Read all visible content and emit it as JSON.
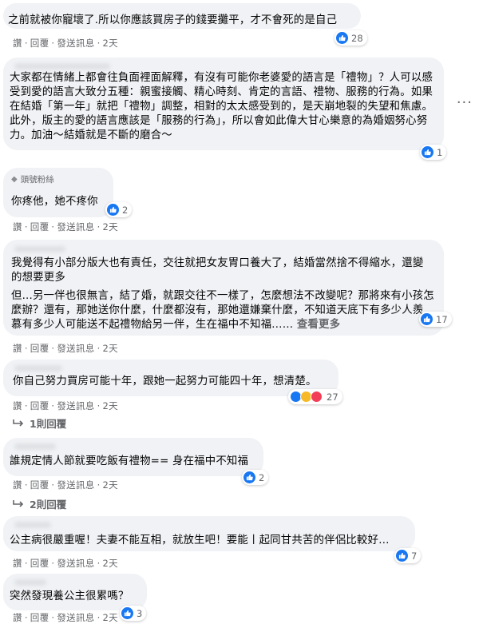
{
  "comments": [
    {
      "text": "之前就被你寵壞了.所以你應該買房子的錢要攤平，才不會死的是自己",
      "reactions": "28",
      "time": "2天"
    },
    {
      "text": "大家都在情緒上都會往負面裡面解釋，有沒有可能你老婆愛的語言是「禮物」？人可以感受到愛的語言大致分五種：親蜜接觸、精心時刻、肯定的言語、禮物、服務的行為。如果在結婚「第一年」就把「禮物」調整，相對的太太感受到的，是天崩地裂的失望和焦慮。此外，版主的愛的語言應該是「服務的行為」，所以會如此偉大甘心樂意的為婚姻努心努力。加油～結婚就是不斷的磨合～",
      "reactions": "1"
    },
    {
      "badge": "頭號粉絲",
      "text": "你疼他，她不疼你",
      "reactions": "2",
      "time": "2天"
    },
    {
      "text": "我覺得有小部分版大也有責任，交往就把女友胃口養大了，結婚當然捨不得縮水，還變的想要更多",
      "text2": "但...另一伴也很無言，結了婚，就跟交往不一樣了，怎麼想法不改變呢？那將來有小孩怎麼辦？還有，那她送你什麼，什麼都沒有，那她還嫌棄什麼，不知道天底下有多少人羨慕有多少人可能送不起禮物給另一伴，生在福中不知福……",
      "see_more": "查看更多",
      "reactions": "17",
      "time": "2天"
    },
    {
      "text": "你自己努力買房可能十年，跟她一起努力可能四十年，想清楚。",
      "reactions": "27",
      "time": "2天",
      "replies": "1則回覆"
    },
    {
      "text": "誰規定情人節就要吃飯有禮物== 身在福中不知福",
      "reactions": "2",
      "time": "2天",
      "replies": "2則回覆"
    },
    {
      "text": "公主病很嚴重喔！夫妻不能互相，就放生吧！要能丨起同甘共苦的伴侶比較好…",
      "reactions": "7",
      "time": "2天"
    },
    {
      "text": "突然發現養公主很累嗎？",
      "reactions": "3",
      "time": "2天"
    }
  ],
  "actions": {
    "like": "讚",
    "reply": "回覆",
    "message": "發送訊息",
    "dot": "·"
  },
  "more_icon": "···",
  "colors": {
    "bubble": "#f0f2f5",
    "like": "#1877f2",
    "meta": "#65676b"
  }
}
